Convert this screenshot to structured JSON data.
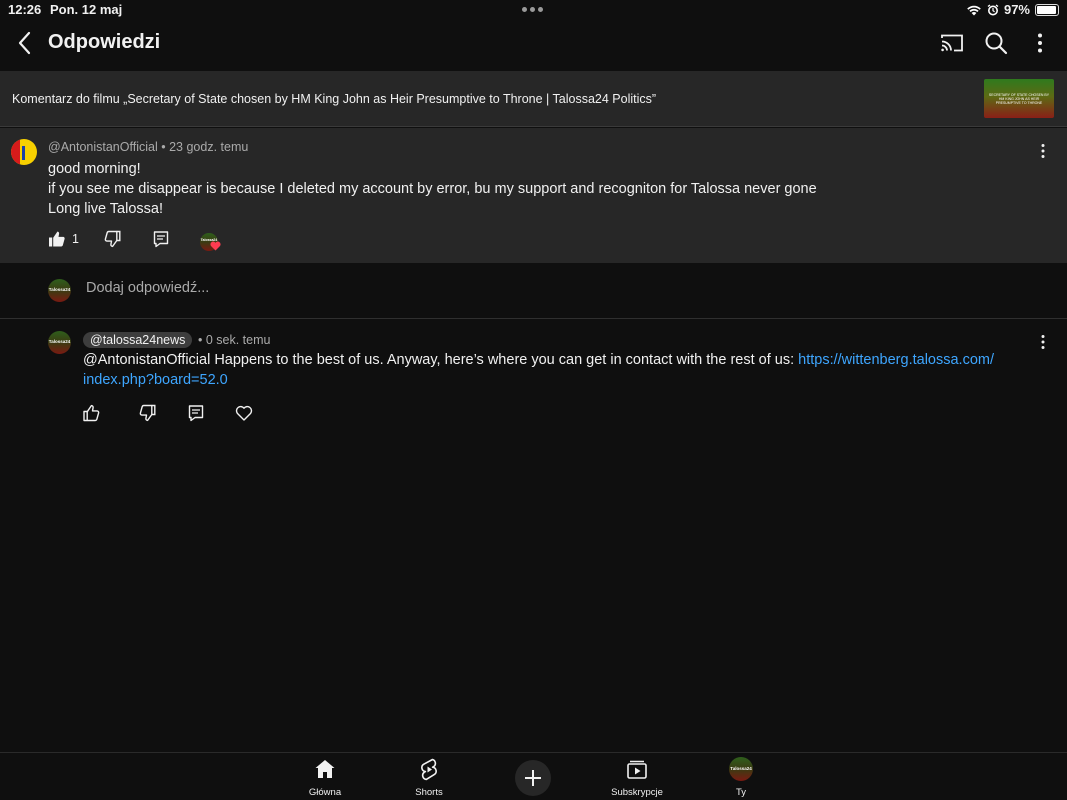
{
  "status_bar": {
    "time": "12:26",
    "date": "Pon. 12 maj",
    "battery": "97%",
    "battery_level": 0.97
  },
  "header": {
    "title": "Odpowiedzi",
    "icons": [
      "back-icon",
      "cast-icon",
      "search-icon",
      "more-vertical-icon"
    ]
  },
  "video": {
    "caption": "Komentarz do filmu „Secretary of State chosen by HM King John as Heir Presumptive to Throne | Talossa24 Politics”",
    "thumbnail_text": "SECRETARY OF STATE CHOSEN BY HM KING JOHN AS HEIR PRESUMPTIVE TO THRONE"
  },
  "parent_comment": {
    "author": "@AntonistanOfficial",
    "time": "23 godz. temu",
    "lines": [
      "good morning!",
      "if you see me disappear is because I deleted my account by error, bu my support and recogniton for Talossa never gone",
      "Long live Talossa!"
    ],
    "like_count": "1",
    "creator_badge": "Talossa24"
  },
  "add_reply": {
    "placeholder": "Dodaj odpowiedź...",
    "avatar_text": "Talossa24"
  },
  "reply": {
    "author": "@talossa24news",
    "time": "0 sek. temu",
    "text": "@AntonistanOfficial Happens to the best of us. Anyway, here’s where you can get in contact with the rest of us: ",
    "link_part1": "https://wittenberg.talossa.com/",
    "link_part2": "index.php?board=52.0",
    "avatar_text": "Talossa24"
  },
  "bottom_nav": {
    "home": "Główna",
    "shorts": "Shorts",
    "subscriptions": "Subskrypcje",
    "you": "Ty",
    "you_avatar_text": "Talossa24"
  },
  "colors": {
    "background": "#0f0f0f",
    "surface": "#272727",
    "link": "#3ea6ff",
    "secondary_text": "#aaaaaa",
    "heart": "#ff3c50"
  }
}
